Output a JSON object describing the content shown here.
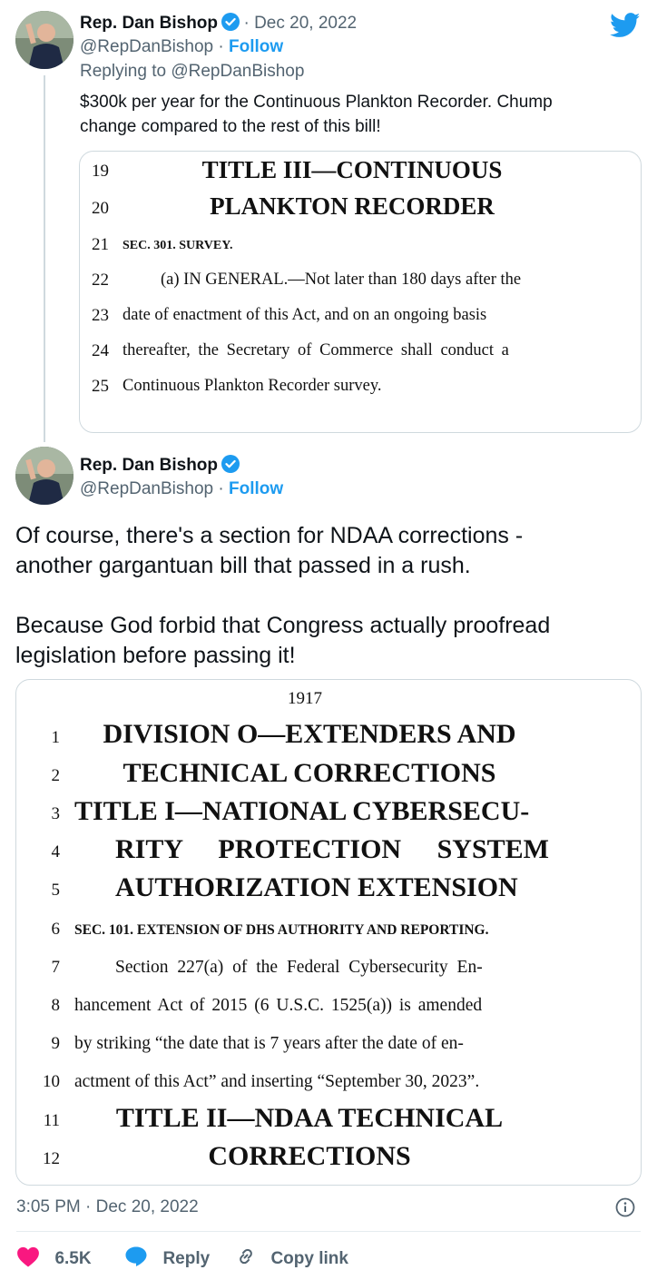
{
  "tweet1": {
    "name": "Rep. Dan Bishop",
    "date": "Dec 20, 2022",
    "handle": "@RepDanBishop",
    "follow": "Follow",
    "replying": "Replying to @RepDanBishop",
    "text_line1": "$300k per year for the Continuous Plankton Recorder. Chump",
    "text_line2": "change compared to the rest of this bill!",
    "doc": {
      "lines": [
        {
          "n": "19",
          "text": "TITLE III—CONTINUOUS"
        },
        {
          "n": "20",
          "text": "PLANKTON RECORDER"
        },
        {
          "n": "21",
          "text": "SEC. 301. SURVEY."
        },
        {
          "n": "22",
          "text": "(a) IN GENERAL.—Not later than 180 days after the"
        },
        {
          "n": "23",
          "text": "date of enactment of this Act, and on an ongoing basis"
        },
        {
          "n": "24",
          "text": "thereafter, the Secretary of Commerce shall conduct a"
        },
        {
          "n": "25",
          "text": "Continuous Plankton Recorder survey."
        }
      ]
    }
  },
  "tweet2": {
    "name": "Rep. Dan Bishop",
    "handle": "@RepDanBishop",
    "follow": "Follow",
    "text_line1": "Of course, there's a section for NDAA corrections -",
    "text_line2": "another gargantuan bill that passed in a rush.",
    "text_line3": "Because God forbid that Congress actually proofread",
    "text_line4": "legislation before passing it!",
    "doc": {
      "page": "1917",
      "lines": [
        {
          "n": "1",
          "text": "DIVISION O—EXTENDERS AND"
        },
        {
          "n": "2",
          "text": "TECHNICAL CORRECTIONS"
        },
        {
          "n": "3",
          "text": "TITLE I—NATIONAL CYBERSECU-"
        },
        {
          "n": "4",
          "text": "RITY PROTECTION SYSTEM"
        },
        {
          "n": "5",
          "text": "AUTHORIZATION EXTENSION"
        },
        {
          "n": "6",
          "text": "SEC. 101. EXTENSION OF DHS AUTHORITY AND REPORTING."
        },
        {
          "n": "7",
          "text": "Section 227(a) of the Federal Cybersecurity En-"
        },
        {
          "n": "8",
          "text": "hancement Act of 2015 (6 U.S.C. 1525(a)) is amended"
        },
        {
          "n": "9",
          "text": "by striking “the date that is 7 years after the date of en-"
        },
        {
          "n": "10",
          "text": "actment of this Act” and inserting “September 30, 2023”."
        },
        {
          "n": "11",
          "text": "TITLE II—NDAA TECHNICAL"
        },
        {
          "n": "12",
          "text": "CORRECTIONS"
        }
      ]
    },
    "timestamp": "3:05 PM · Dec 20, 2022"
  },
  "actions": {
    "likes": "6.5K",
    "reply": "Reply",
    "copy_link": "Copy link"
  },
  "colors": {
    "twitter_blue": "#1d9bf0",
    "like_red": "#f91880",
    "muted": "#536471"
  },
  "icons": [
    "twitter-bird-icon",
    "verified-badge-icon",
    "info-icon",
    "heart-icon",
    "reply-bubble-icon",
    "link-icon"
  ]
}
